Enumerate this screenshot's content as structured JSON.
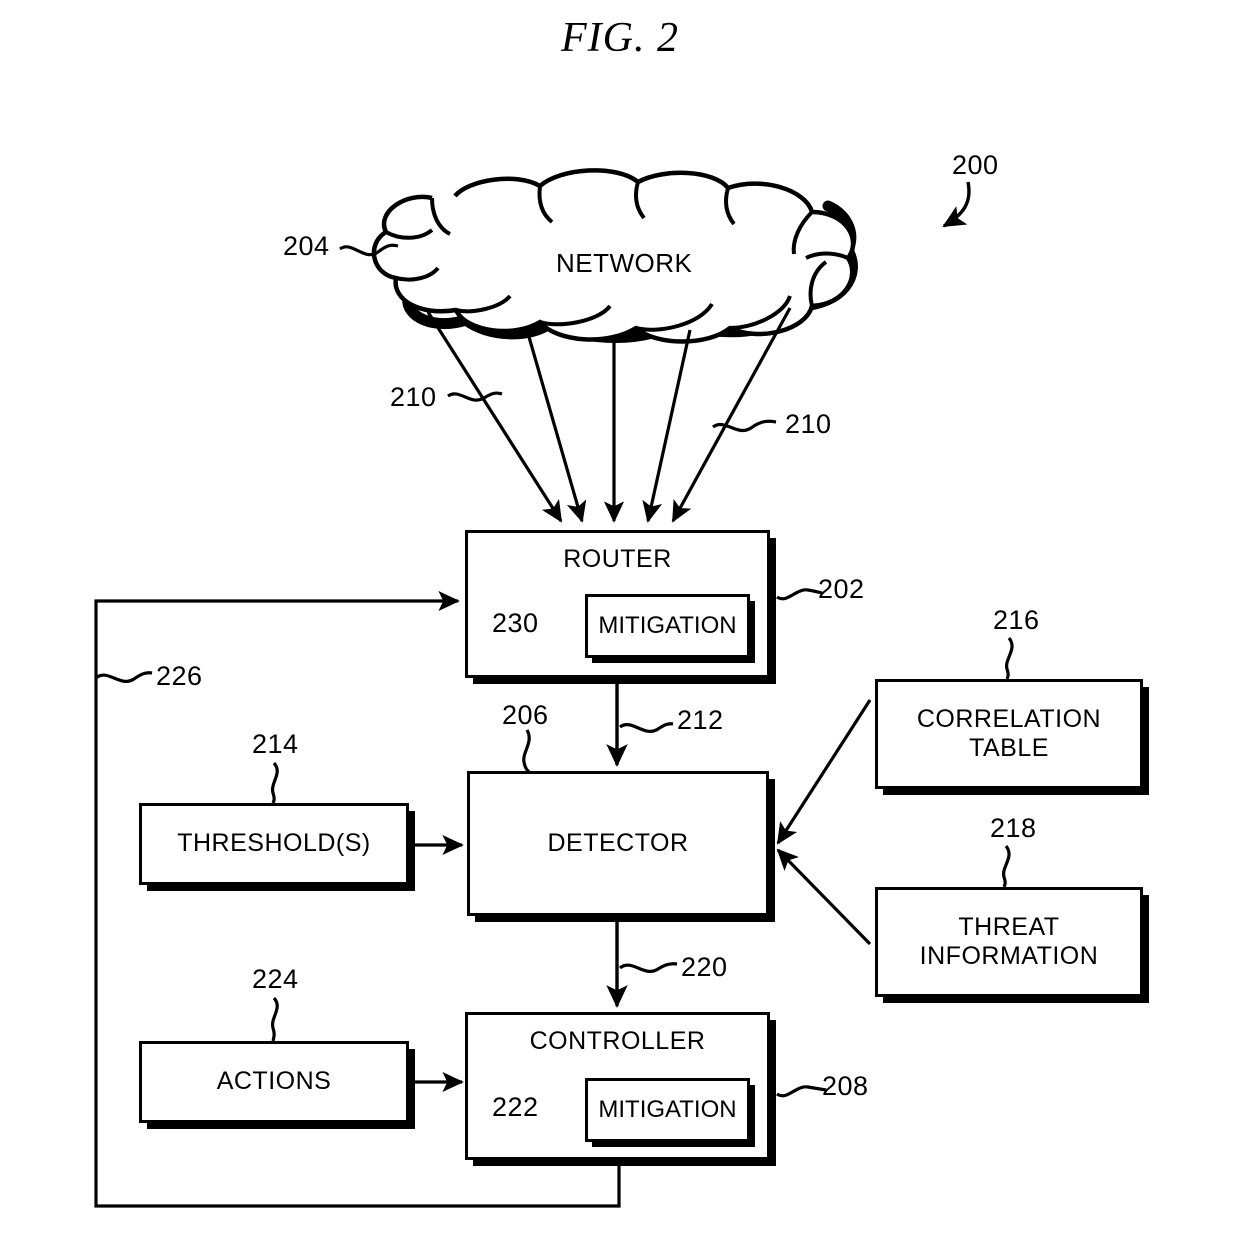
{
  "figure": {
    "title": "FIG. 2",
    "system_ref": "200"
  },
  "nodes": {
    "network": {
      "label": "NETWORK",
      "ref": "204",
      "shape": "cloud"
    },
    "router": {
      "label": "ROUTER",
      "ref": "202"
    },
    "router_mitigation": {
      "label": "MITIGATION",
      "ref": "230"
    },
    "detector": {
      "label": "DETECTOR",
      "ref": "206"
    },
    "controller": {
      "label": "CONTROLLER",
      "ref": "208"
    },
    "controller_mitigation": {
      "label": "MITIGATION",
      "ref": "222"
    },
    "thresholds": {
      "label": "THRESHOLD(S)",
      "ref": "214"
    },
    "actions": {
      "label": "ACTIONS",
      "ref": "224"
    },
    "correlation_table": {
      "label": "CORRELATION\nTABLE",
      "ref": "216"
    },
    "threat_information": {
      "label": "THREAT\nINFORMATION",
      "ref": "218"
    }
  },
  "connections": {
    "network_to_router_left": {
      "ref": "210"
    },
    "network_to_router_right": {
      "ref": "210"
    },
    "router_to_detector": {
      "ref": "212"
    },
    "detector_to_controller": {
      "ref": "220"
    },
    "controller_feedback_to_router": {
      "ref": "226"
    }
  },
  "colors": {
    "ink": "#000000",
    "background": "#ffffff"
  }
}
